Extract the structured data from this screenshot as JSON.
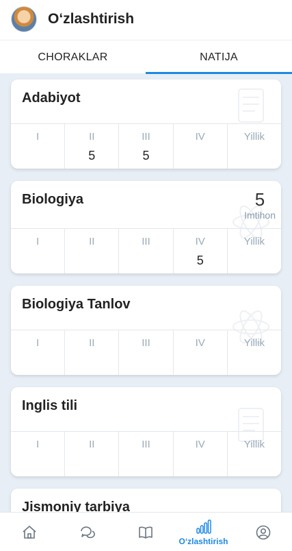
{
  "header": {
    "title": "O‘zlashtirish"
  },
  "tabs": [
    {
      "label": "CHORAKLAR"
    },
    {
      "label": "NATIJA"
    }
  ],
  "columns": [
    "I",
    "II",
    "III",
    "IV",
    "Yillik"
  ],
  "subjects": [
    {
      "name": "Adabiyot",
      "grades": [
        "",
        "5",
        "5",
        "",
        ""
      ]
    },
    {
      "name": "Biologiya",
      "exam_grade": "5",
      "exam_label": "Imtihon",
      "grades": [
        "",
        "",
        "",
        "5",
        ""
      ]
    },
    {
      "name": "Biologiya Tanlov",
      "grades": [
        "",
        "",
        "",
        "",
        ""
      ]
    },
    {
      "name": "Inglis tili",
      "grades": [
        "",
        "",
        "",
        "",
        ""
      ]
    },
    {
      "name": "Jismoniy tarbiya",
      "grades": [
        "",
        "",
        "",
        "",
        ""
      ]
    }
  ],
  "bottom_nav": {
    "items": [
      {
        "icon": "home-icon"
      },
      {
        "icon": "chat-icon"
      },
      {
        "icon": "book-icon"
      },
      {
        "icon": "bar-chart-icon",
        "label": "O‘zlashtirish",
        "active": true
      },
      {
        "icon": "profile-icon"
      }
    ]
  },
  "colors": {
    "accent": "#1e88e5",
    "background": "#e8eef5"
  }
}
